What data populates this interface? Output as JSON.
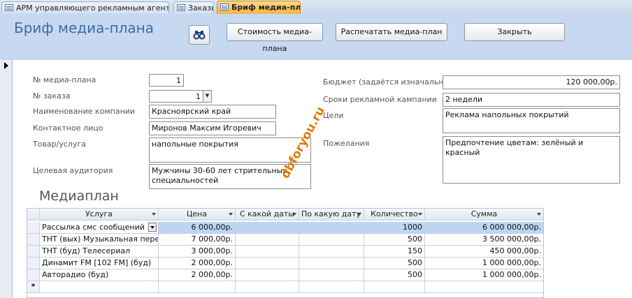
{
  "tabs": [
    {
      "label": "АРМ управляющего рекламным агентством",
      "active": false
    },
    {
      "label": "Заказы",
      "active": false
    },
    {
      "label": "Бриф медиа-плана",
      "active": true
    }
  ],
  "header": {
    "title": "Бриф медиа-плана",
    "buttons": {
      "binoculars": "binoculars-icon",
      "cost": "Стоимость медиа-плана",
      "print": "Распечатать медиа-план",
      "close": "Закрыть"
    }
  },
  "form": {
    "mediaplan_no_label": "№ медиа-плана",
    "mediaplan_no_value": "1",
    "order_no_label": "№ заказа",
    "order_no_value": "1",
    "company_label": "Наименование компании",
    "company_value": "Красноярский край",
    "contact_label": "Контактное лицо",
    "contact_value": "Миронов Максим Игоревич",
    "product_label": "Товар/услуга",
    "product_value": "напольные покрытия",
    "audience_label": "Целевая аудитория",
    "audience_value": "Мужчины 30-60 лет стрительных специальностей",
    "budget_label": "Бюджет (задаётся изначально)",
    "budget_value": "120 000,00р.",
    "period_label": "Сроки рекламной кампании",
    "period_value": "2 недели",
    "goal_label": "Цели",
    "goal_value": "Реклама напольных покрытий",
    "wishes_label": "Пожелания",
    "wishes_value": "Предпочтение цветам: зелёный и красный"
  },
  "watermark": "dbforyou.ru",
  "mediaplan": {
    "title": "Медиаплан",
    "columns": [
      "Услуга",
      "Цена",
      "С какой даты",
      "По какую дату",
      "Количество",
      "Сумма"
    ],
    "rows": [
      {
        "service": "Рассылка смс сообщений",
        "price": "6 000,00р.",
        "from": "",
        "to": "",
        "qty": "1000",
        "sum": "6 000 000,00р."
      },
      {
        "service": "ТНТ (вых) Музыкальная передача",
        "price": "7 000,00р.",
        "from": "",
        "to": "",
        "qty": "500",
        "sum": "3 500 000,00р."
      },
      {
        "service": "ТНТ (буд) Телесериал",
        "price": "3 000,00р.",
        "from": "",
        "to": "",
        "qty": "150",
        "sum": "450 000,00р."
      },
      {
        "service": "Динамит FM [102 FM] (буд)",
        "price": "2 000,00р.",
        "from": "",
        "to": "",
        "qty": "500",
        "sum": "1 000 000,00р."
      },
      {
        "service": "Авторадио (буд)",
        "price": "2 000,00р.",
        "from": "",
        "to": "",
        "qty": "500",
        "sum": "1 000 000,00р."
      }
    ],
    "new_row_marker": "*"
  }
}
